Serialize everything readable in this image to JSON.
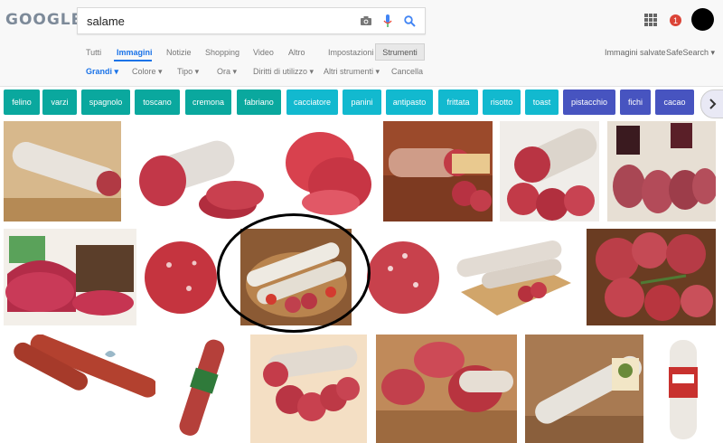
{
  "logo": "GOOGLE",
  "search": {
    "query": "salame"
  },
  "icons": {
    "camera": "camera-icon",
    "mic": "microphone-icon",
    "search": "search-icon",
    "apps": "apps-grid-icon",
    "next": "chevron-right-icon"
  },
  "header": {
    "notification_count": "1"
  },
  "nav_tabs": [
    "Tutti",
    "Immagini",
    "Notizie",
    "Shopping",
    "Video",
    "Altro",
    "Impostazioni",
    "Strumenti"
  ],
  "right_links": {
    "saved": "Immagini salvate",
    "safesearch": "SafeSearch ▾"
  },
  "filters": [
    "Grandi ▾",
    "Colore ▾",
    "Tipo ▾",
    "Ora ▾",
    "Diritti di utilizzo ▾",
    "Altri strumenti ▾",
    "Cancella"
  ],
  "chips": [
    {
      "label": "felino",
      "color": "#0aa89e"
    },
    {
      "label": "varzi",
      "color": "#0aa89e"
    },
    {
      "label": "spagnolo",
      "color": "#0aa89e"
    },
    {
      "label": "toscano",
      "color": "#0aa89e"
    },
    {
      "label": "cremona",
      "color": "#0aa89e"
    },
    {
      "label": "fabriano",
      "color": "#0aa89e"
    },
    {
      "label": "cacciatore",
      "color": "#12b9cf"
    },
    {
      "label": "panini",
      "color": "#12b9cf"
    },
    {
      "label": "antipasto",
      "color": "#12b9cf"
    },
    {
      "label": "frittata",
      "color": "#12b9cf"
    },
    {
      "label": "risotto",
      "color": "#12b9cf"
    },
    {
      "label": "toast",
      "color": "#12b9cf"
    },
    {
      "label": "pistacchio",
      "color": "#4754c0"
    },
    {
      "label": "fichi",
      "color": "#4754c0"
    },
    {
      "label": "cacao",
      "color": "#4754c0"
    }
  ],
  "colors": {
    "accent": "#1a73e8",
    "badge": "#db4437",
    "annotation": "#000000"
  }
}
